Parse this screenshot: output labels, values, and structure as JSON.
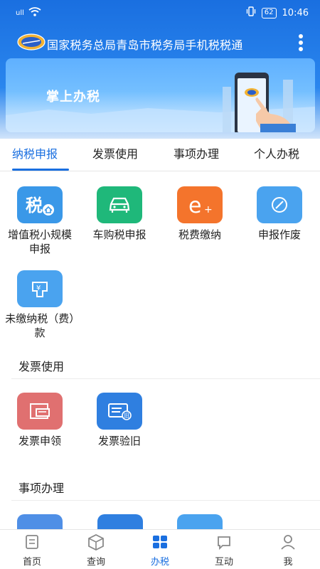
{
  "statusbar": {
    "signal": "ull",
    "battery": "62",
    "time": "10:46"
  },
  "header": {
    "title": "国家税务总局青岛市税务局手机税税通"
  },
  "banner": {
    "title": "掌上办税"
  },
  "tabs": [
    {
      "label": "纳税申报",
      "active": true
    },
    {
      "label": "发票使用",
      "active": false
    },
    {
      "label": "事项办理",
      "active": false
    },
    {
      "label": "个人办税",
      "active": false
    }
  ],
  "tax_declaration": [
    {
      "label": "增值税小规模申报",
      "icon": "tax-house-icon",
      "color": "#3a98e8"
    },
    {
      "label": "车购税申报",
      "icon": "car-icon",
      "color": "#1fb87a"
    },
    {
      "label": "税费缴纳",
      "icon": "e-plus-icon",
      "color": "#f4742c"
    },
    {
      "label": "申报作废",
      "icon": "void-icon",
      "color": "#4aa3ef"
    },
    {
      "label": "未缴纳税（费）款",
      "icon": "unpaid-icon",
      "color": "#4aa3ef"
    }
  ],
  "invoice_section": {
    "title": "发票使用",
    "items": [
      {
        "label": "发票申领",
        "icon": "invoice-apply-icon",
        "color": "#e07070"
      },
      {
        "label": "发票验旧",
        "icon": "invoice-check-icon",
        "color": "#2f7fe0"
      }
    ]
  },
  "matters_section": {
    "title": "事项办理"
  },
  "bottomnav": [
    {
      "label": "首页",
      "icon": "home-icon",
      "active": false
    },
    {
      "label": "查询",
      "icon": "box-icon",
      "active": false
    },
    {
      "label": "办税",
      "icon": "grid-icon",
      "active": true
    },
    {
      "label": "互动",
      "icon": "chat-icon",
      "active": false
    },
    {
      "label": "我",
      "icon": "user-icon",
      "active": false
    }
  ],
  "colors": {
    "primary": "#1a6fe0"
  }
}
